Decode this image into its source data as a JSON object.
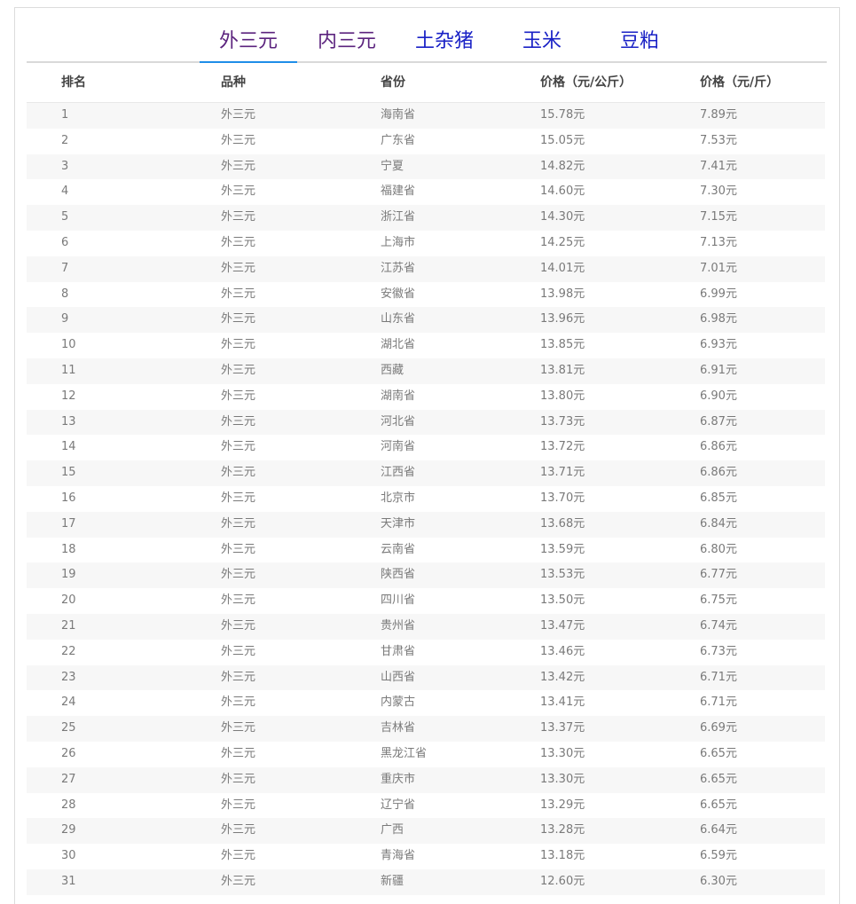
{
  "tabs": [
    {
      "label": "外三元"
    },
    {
      "label": "内三元"
    },
    {
      "label": "土杂猪"
    },
    {
      "label": "玉米"
    },
    {
      "label": "豆粕"
    }
  ],
  "table": {
    "headers": [
      "排名",
      "品种",
      "省份",
      "价格（元/公斤）",
      "价格（元/斤）"
    ],
    "rows": [
      [
        "1",
        "外三元",
        "海南省",
        "15.78元",
        "7.89元"
      ],
      [
        "2",
        "外三元",
        "广东省",
        "15.05元",
        "7.53元"
      ],
      [
        "3",
        "外三元",
        "宁夏",
        "14.82元",
        "7.41元"
      ],
      [
        "4",
        "外三元",
        "福建省",
        "14.60元",
        "7.30元"
      ],
      [
        "5",
        "外三元",
        "浙江省",
        "14.30元",
        "7.15元"
      ],
      [
        "6",
        "外三元",
        "上海市",
        "14.25元",
        "7.13元"
      ],
      [
        "7",
        "外三元",
        "江苏省",
        "14.01元",
        "7.01元"
      ],
      [
        "8",
        "外三元",
        "安徽省",
        "13.98元",
        "6.99元"
      ],
      [
        "9",
        "外三元",
        "山东省",
        "13.96元",
        "6.98元"
      ],
      [
        "10",
        "外三元",
        "湖北省",
        "13.85元",
        "6.93元"
      ],
      [
        "11",
        "外三元",
        "西藏",
        "13.81元",
        "6.91元"
      ],
      [
        "12",
        "外三元",
        "湖南省",
        "13.80元",
        "6.90元"
      ],
      [
        "13",
        "外三元",
        "河北省",
        "13.73元",
        "6.87元"
      ],
      [
        "14",
        "外三元",
        "河南省",
        "13.72元",
        "6.86元"
      ],
      [
        "15",
        "外三元",
        "江西省",
        "13.71元",
        "6.86元"
      ],
      [
        "16",
        "外三元",
        "北京市",
        "13.70元",
        "6.85元"
      ],
      [
        "17",
        "外三元",
        "天津市",
        "13.68元",
        "6.84元"
      ],
      [
        "18",
        "外三元",
        "云南省",
        "13.59元",
        "6.80元"
      ],
      [
        "19",
        "外三元",
        "陕西省",
        "13.53元",
        "6.77元"
      ],
      [
        "20",
        "外三元",
        "四川省",
        "13.50元",
        "6.75元"
      ],
      [
        "21",
        "外三元",
        "贵州省",
        "13.47元",
        "6.74元"
      ],
      [
        "22",
        "外三元",
        "甘肃省",
        "13.46元",
        "6.73元"
      ],
      [
        "23",
        "外三元",
        "山西省",
        "13.42元",
        "6.71元"
      ],
      [
        "24",
        "外三元",
        "内蒙古",
        "13.41元",
        "6.71元"
      ],
      [
        "25",
        "外三元",
        "吉林省",
        "13.37元",
        "6.69元"
      ],
      [
        "26",
        "外三元",
        "黑龙江省",
        "13.30元",
        "6.65元"
      ],
      [
        "27",
        "外三元",
        "重庆市",
        "13.30元",
        "6.65元"
      ],
      [
        "28",
        "外三元",
        "辽宁省",
        "13.29元",
        "6.65元"
      ],
      [
        "29",
        "外三元",
        "广西",
        "13.28元",
        "6.64元"
      ],
      [
        "30",
        "外三元",
        "青海省",
        "13.18元",
        "6.59元"
      ],
      [
        "31",
        "外三元",
        "新疆",
        "12.60元",
        "6.30元"
      ]
    ]
  }
}
